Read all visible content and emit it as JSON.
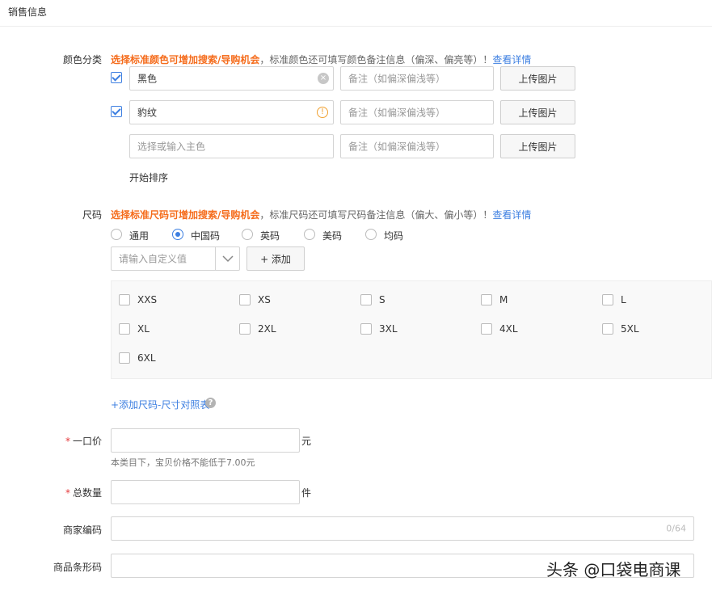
{
  "section": {
    "title": "销售信息"
  },
  "color": {
    "label": "颜色分类",
    "hint_strong": "选择标准颜色可增加搜索/导购机会",
    "hint_normal": "，标准颜色还可填写颜色备注信息（偏深、偏亮等）！",
    "hint_link": "查看详情",
    "rows": [
      {
        "checked": true,
        "value": "黑色",
        "note_placeholder": "备注（如偏深偏浅等）",
        "upload_label": "上传图片"
      },
      {
        "checked": true,
        "value": "豹纹",
        "note_placeholder": "备注（如偏深偏浅等）",
        "upload_label": "上传图片"
      },
      {
        "checked": false,
        "placeholder": "选择或输入主色",
        "note_placeholder": "备注（如偏深偏浅等）",
        "upload_label": "上传图片"
      }
    ],
    "sort_label": "开始排序"
  },
  "size": {
    "label": "尺码",
    "hint_strong": "选择标准尺码可增加搜索/导购机会",
    "hint_normal": "，标准尺码还可填写尺码备注信息（偏大、偏小等）！",
    "hint_link": "查看详情",
    "types": [
      {
        "label": "通用",
        "selected": false
      },
      {
        "label": "中国码",
        "selected": true
      },
      {
        "label": "英码",
        "selected": false
      },
      {
        "label": "美码",
        "selected": false
      },
      {
        "label": "均码",
        "selected": false
      }
    ],
    "custom_placeholder": "请输入自定义值",
    "add_label": "+ 添加",
    "options": [
      "XXS",
      "XS",
      "S",
      "M",
      "L",
      "XL",
      "2XL",
      "3XL",
      "4XL",
      "5XL",
      "6XL"
    ],
    "chart_link": "+添加尺码-尺寸对照表"
  },
  "price": {
    "required_mark": "*",
    "label": "一口价",
    "unit": "元",
    "note": "本类目下，宝贝价格不能低于7.00元"
  },
  "quantity": {
    "required_mark": "*",
    "label": "总数量",
    "unit": "件"
  },
  "merchant_code": {
    "label": "商家编码",
    "counter": "0/64"
  },
  "barcode": {
    "label": "商品条形码"
  },
  "watermark": {
    "text": "头条 @口袋电商课"
  }
}
